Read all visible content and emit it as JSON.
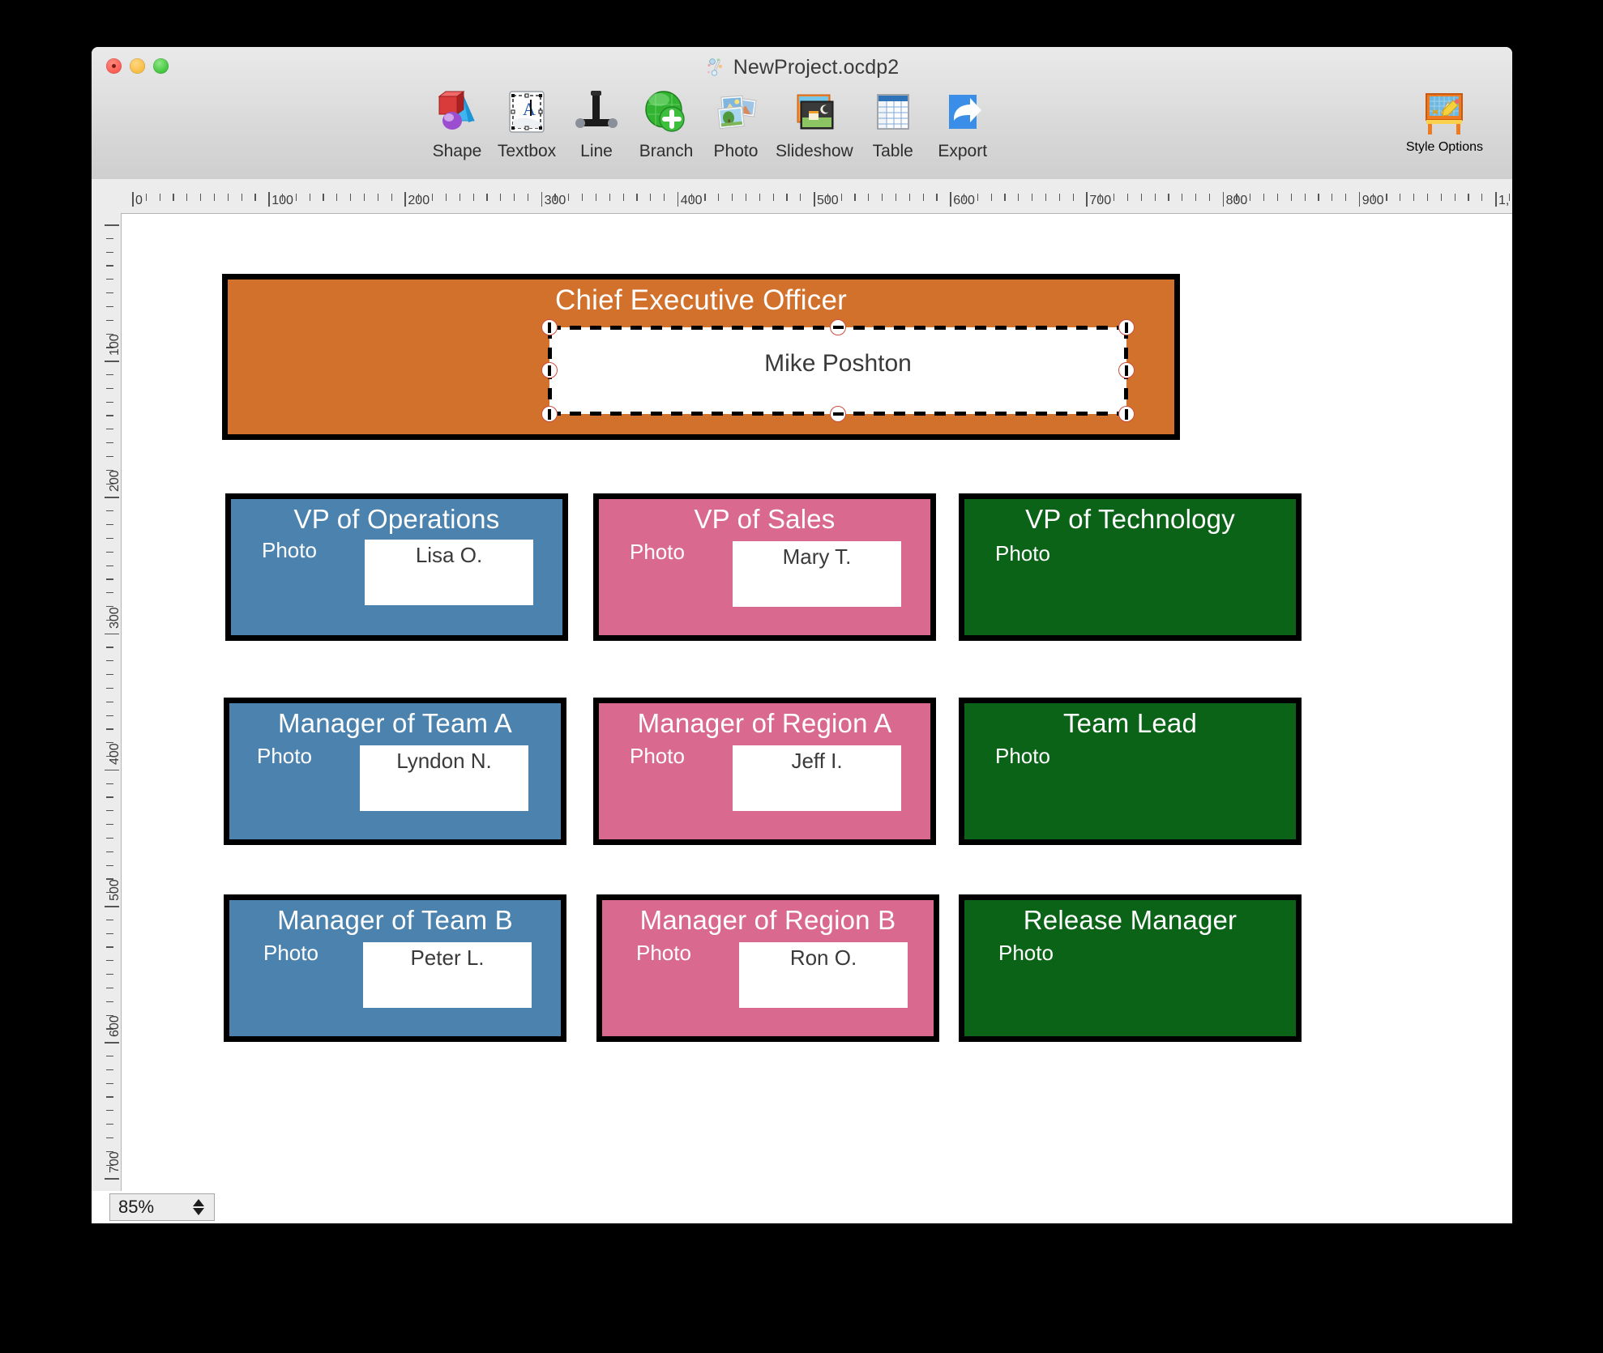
{
  "window": {
    "title": "NewProject.ocdp2",
    "doc_icon": "omnigraffle-document-icon",
    "traffic_lights": [
      "close-button",
      "minimize-button",
      "zoom-button"
    ]
  },
  "toolbar": {
    "items": [
      {
        "label": "Shape",
        "icon": "shape-icon"
      },
      {
        "label": "Textbox",
        "icon": "textbox-icon"
      },
      {
        "label": "Line",
        "icon": "line-icon"
      },
      {
        "label": "Branch",
        "icon": "branch-icon"
      },
      {
        "label": "Photo",
        "icon": "photo-icon"
      },
      {
        "label": "Slideshow",
        "icon": "slideshow-icon"
      },
      {
        "label": "Table",
        "icon": "table-icon"
      },
      {
        "label": "Export",
        "icon": "export-icon"
      }
    ],
    "style_options": {
      "label": "Style Options",
      "icon": "style-options-icon"
    }
  },
  "rulers": {
    "horizontal_labels": [
      "0",
      "100",
      "200",
      "300",
      "400",
      "500",
      "600",
      "700",
      "800",
      "900",
      "1,"
    ],
    "vertical_labels": [
      "100",
      "200",
      "300",
      "400",
      "500",
      "600",
      "700"
    ],
    "unit_step": 100,
    "minor_ticks_per_major": 10
  },
  "colors": {
    "orange": "#D2712C",
    "blue": "#4B82AE",
    "pink": "#D9698E",
    "green": "#0B6318",
    "shape_border": "#000000",
    "name_box": "#FFFFFF",
    "title_text": "#FFFFFF",
    "name_text": "#3A3A3A",
    "handle_fill": "#FFFFFF",
    "handle_stroke": "#C9503E"
  },
  "canvas": {
    "shapes": [
      {
        "id": "ceo",
        "title": "Chief Executive Officer",
        "color_key": "orange",
        "photo_label": null,
        "name": "Mike Poshton",
        "selected": true
      },
      {
        "id": "vp-operations",
        "title": "VP of Operations",
        "color_key": "blue",
        "photo_label": "Photo",
        "name": "Lisa O.",
        "selected": false
      },
      {
        "id": "vp-sales",
        "title": "VP of Sales",
        "color_key": "pink",
        "photo_label": "Photo",
        "name": "Mary T.",
        "selected": false
      },
      {
        "id": "vp-technology",
        "title": "VP of Technology",
        "color_key": "green",
        "photo_label": "Photo",
        "name": null,
        "selected": false
      },
      {
        "id": "manager-team-a",
        "title": "Manager of Team A",
        "color_key": "blue",
        "photo_label": "Photo",
        "name": "Lyndon N.",
        "selected": false
      },
      {
        "id": "manager-region-a",
        "title": "Manager of Region A",
        "color_key": "pink",
        "photo_label": "Photo",
        "name": "Jeff I.",
        "selected": false
      },
      {
        "id": "team-lead",
        "title": "Team Lead",
        "color_key": "green",
        "photo_label": "Photo",
        "name": null,
        "selected": false
      },
      {
        "id": "manager-team-b",
        "title": "Manager of Team B",
        "color_key": "blue",
        "photo_label": "Photo",
        "name": "Peter L.",
        "selected": false
      },
      {
        "id": "manager-region-b",
        "title": "Manager of Region B",
        "color_key": "pink",
        "photo_label": "Photo",
        "name": "Ron O.",
        "selected": false
      },
      {
        "id": "release-manager",
        "title": "Release Manager",
        "color_key": "green",
        "photo_label": "Photo",
        "name": null,
        "selected": false
      }
    ]
  },
  "statusbar": {
    "zoom_value": "85%",
    "stepper_icon": "stepper-up-down-icon"
  }
}
